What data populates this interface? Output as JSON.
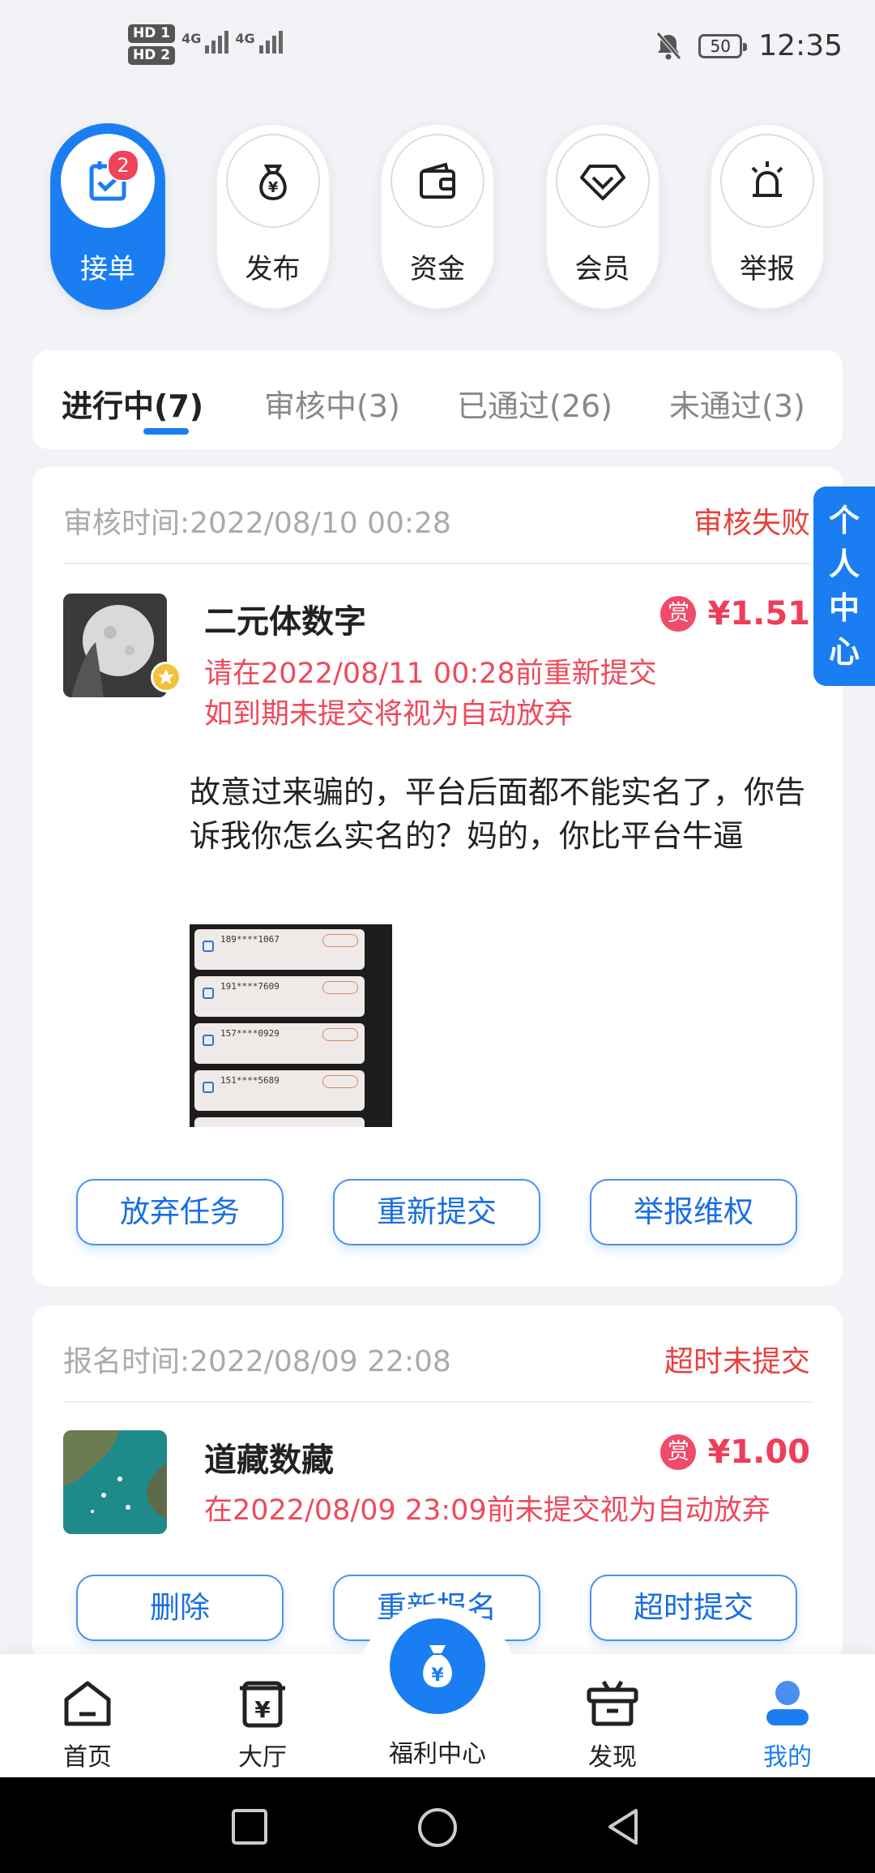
{
  "status_bar": {
    "sim1": "HD 1",
    "sim2": "HD 2",
    "network1": "4G",
    "network2": "4G",
    "battery": "50",
    "time": "12:35"
  },
  "quick_actions": [
    {
      "label": "接单",
      "icon": "task-check-icon",
      "badge": "2",
      "active": true
    },
    {
      "label": "发布",
      "icon": "money-bag-icon"
    },
    {
      "label": "资金",
      "icon": "wallet-icon"
    },
    {
      "label": "会员",
      "icon": "diamond-icon"
    },
    {
      "label": "举报",
      "icon": "alarm-siren-icon"
    }
  ],
  "tabs": [
    {
      "label": "进行中(7)",
      "active": true
    },
    {
      "label": "审核中(3)"
    },
    {
      "label": "已通过(26)"
    },
    {
      "label": "未通过(3)"
    }
  ],
  "side_tab": {
    "label": "个人中心"
  },
  "tasks": [
    {
      "time_label": "审核时间:2022/08/10 00:28",
      "status": "审核失败",
      "title": "二元体数字",
      "reward_tag": "赏",
      "price": "¥1.51",
      "notice_line1": "请在2022/08/11 00:28前重新提交",
      "notice_line2": "如到期未提交将视为自动放弃",
      "review_text": "故意过来骗的，平台后面都不能实名了，你告诉我你怎么实名的？妈的，你比平台牛逼",
      "screenshot_rows": [
        "189****1067",
        "191****7609",
        "157****0929",
        "151****5689"
      ],
      "buttons": [
        "放弃任务",
        "重新提交",
        "举报维权"
      ]
    },
    {
      "time_label": "报名时间:2022/08/09 22:08",
      "status": "超时未提交",
      "title": "道藏数藏",
      "reward_tag": "赏",
      "price": "¥1.00",
      "notice_line1": "在2022/08/09 23:09前未提交视为自动放弃",
      "buttons": [
        "删除",
        "重新报名",
        "超时提交"
      ]
    }
  ],
  "bottom_nav": [
    {
      "label": "首页",
      "icon": "home-icon"
    },
    {
      "label": "大厅",
      "icon": "hall-yen-icon"
    },
    {
      "label": "福利中心",
      "icon": "money-bag-icon"
    },
    {
      "label": "发现",
      "icon": "gift-box-icon"
    },
    {
      "label": "我的",
      "icon": "user-icon",
      "active": true
    }
  ],
  "colors": {
    "primary": "#1a7ef2",
    "danger": "#e8413e",
    "price": "#ee3d5a",
    "background": "#f2f3f7"
  }
}
